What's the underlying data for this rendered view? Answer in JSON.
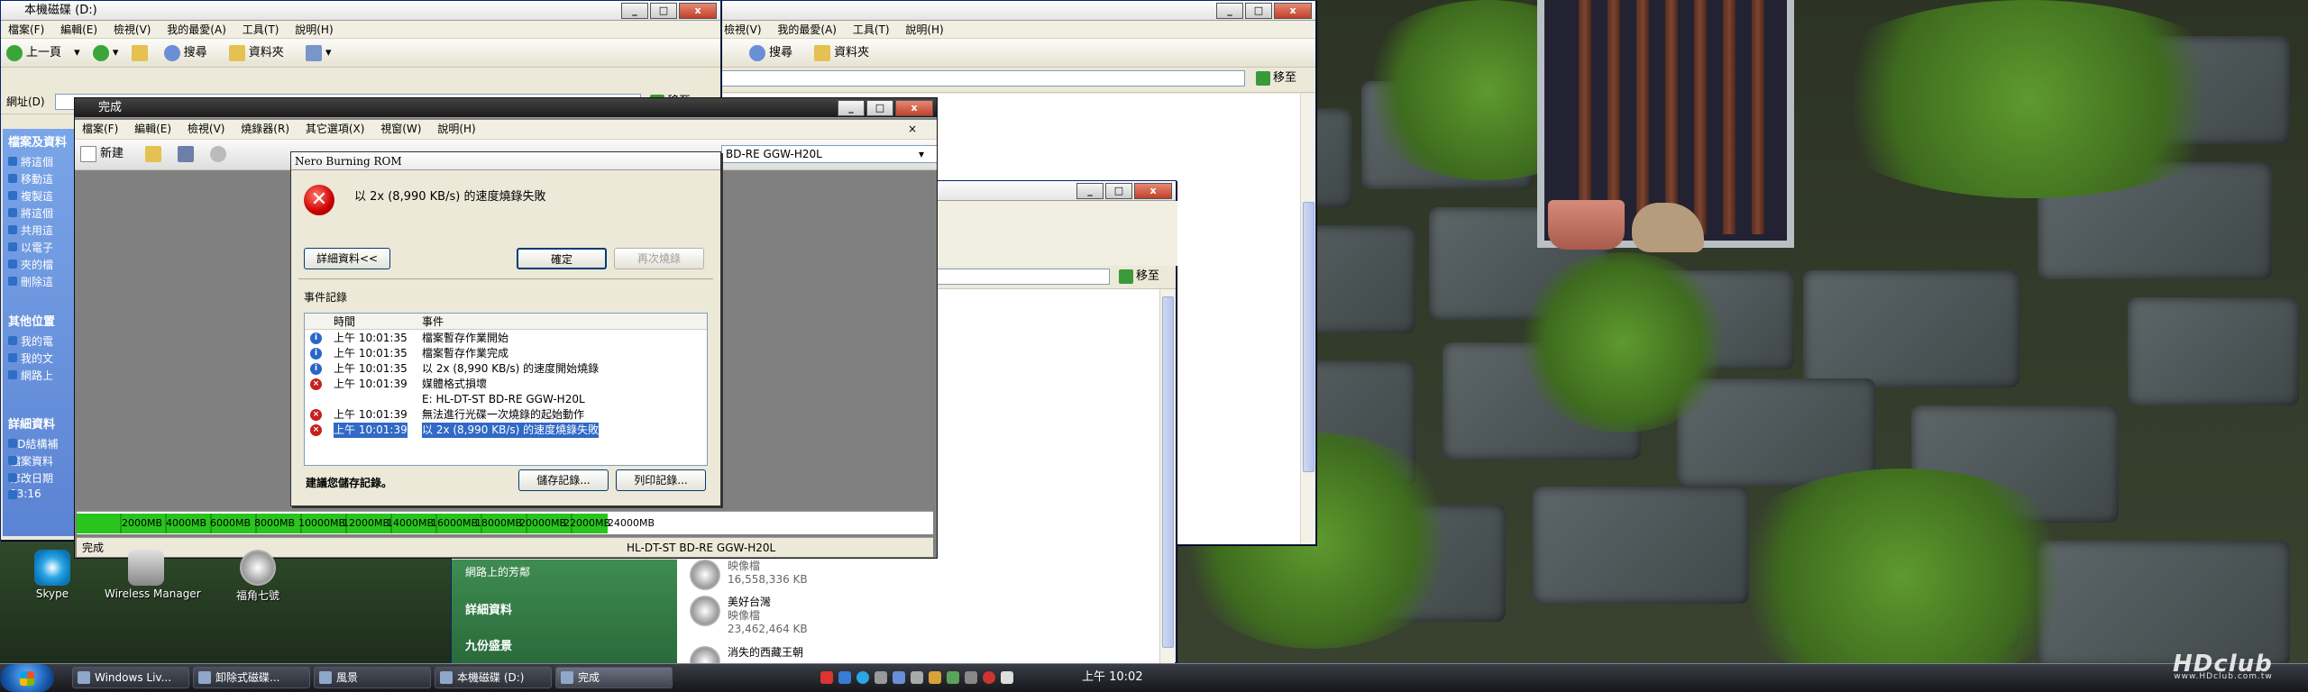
{
  "explorer_back": {
    "title": "本機磁碟 (D:)",
    "menu": [
      "檔案(F)",
      "編輯(E)",
      "檢視(V)",
      "我的最愛(A)",
      "工具(T)",
      "說明(H)"
    ],
    "toolbar": {
      "back": "上一頁",
      "search": "搜尋",
      "folders": "資料夾"
    },
    "address_label": "網址(D)",
    "go_label": "移至",
    "left_sections": [
      {
        "title": "檔案及資料",
        "items": [
          "將這個",
          "移動這",
          "複製這",
          "將這個",
          "共用這",
          "以電子",
          "夾的檔",
          "刪除這"
        ]
      },
      {
        "title": "其他位置",
        "items": [
          "我的電",
          "我的文",
          "網路上"
        ]
      },
      {
        "title": "詳細資料",
        "items": [
          "BD結構補",
          "檔案資料",
          "修改日期",
          "03:16"
        ]
      }
    ]
  },
  "explorer_mid": {
    "menu": [
      "檢視(V)",
      "我的最愛(A)",
      "工具(T)",
      "說明(H)"
    ],
    "toolbar": {
      "search": "搜尋",
      "folders": "資料夾"
    },
    "go_label": "移至"
  },
  "explorer_front": {
    "go_label": "移至",
    "left_items": [
      "網路上的芳鄰",
      "詳細資料",
      "九份盛景"
    ],
    "files": [
      {
        "name": "映像檔",
        "size": "16,558,336 KB"
      },
      {
        "name": "美好台灣",
        "type": "映像檔",
        "size": "23,462,464 KB"
      },
      {
        "name": "消失的西藏王朝"
      }
    ]
  },
  "nero": {
    "title": "完成",
    "menu": [
      "檔案(F)",
      "編輯(E)",
      "檢視(V)",
      "燒錄器(R)",
      "其它選項(X)",
      "視窗(W)",
      "說明(H)"
    ],
    "toolbar_new": "新建",
    "drive": "BD-RE  GGW-H20L",
    "capacity_ticks": [
      "2000MB",
      "4000MB",
      "6000MB",
      "8000MB",
      "10000MB",
      "12000MB",
      "14000MB",
      "16000MB",
      "18000MB",
      "20000MB",
      "22000MB",
      "24000MB"
    ],
    "capacity_fill_fraction": 0.62,
    "status_left": "完成",
    "status_drive": "HL-DT-ST BD-RE  GGW-H20L"
  },
  "dialog": {
    "title": "Nero Burning ROM",
    "message": "以 2x (8,990 KB/s) 的速度燒錄失敗",
    "details_button": "詳細資料<<",
    "ok_button": "確定",
    "retry_button": "再次燒錄",
    "events_label": "事件記錄",
    "col_time": "時間",
    "col_event": "事件",
    "events": [
      {
        "icon": "info",
        "time": "上午 10:01:35",
        "event": "檔案暫存作業開始"
      },
      {
        "icon": "info",
        "time": "上午 10:01:35",
        "event": "檔案暫存作業完成"
      },
      {
        "icon": "info",
        "time": "上午 10:01:35",
        "event": "以 2x (8,990 KB/s) 的速度開始燒錄"
      },
      {
        "icon": "error",
        "time": "上午 10:01:39",
        "event": "媒體格式損壞"
      },
      {
        "icon": "",
        "time": "",
        "event": "E: HL-DT-ST BD-RE  GGW-H20L"
      },
      {
        "icon": "error",
        "time": "上午 10:01:39",
        "event": "無法進行光碟一次燒錄的起始動作"
      },
      {
        "icon": "error",
        "time": "上午 10:01:39",
        "event": "以 2x (8,990 KB/s) 的速度燒錄失敗",
        "selected": true
      }
    ],
    "recommend": "建議您儲存記錄。",
    "save_button": "儲存記錄...",
    "print_button": "列印記錄..."
  },
  "desktop_icons": [
    {
      "label": "Skype"
    },
    {
      "label": "Wireless Manager"
    },
    {
      "label": "福角七號"
    }
  ],
  "taskbar": {
    "buttons": [
      "Windows Liv...",
      "卸除式磁碟...",
      "風景",
      "本機磁碟 (D:)",
      "完成"
    ],
    "clock": "上午 10:02"
  },
  "watermark": {
    "text": "HDclub",
    "sub": "www.HDclub.com.tw"
  }
}
